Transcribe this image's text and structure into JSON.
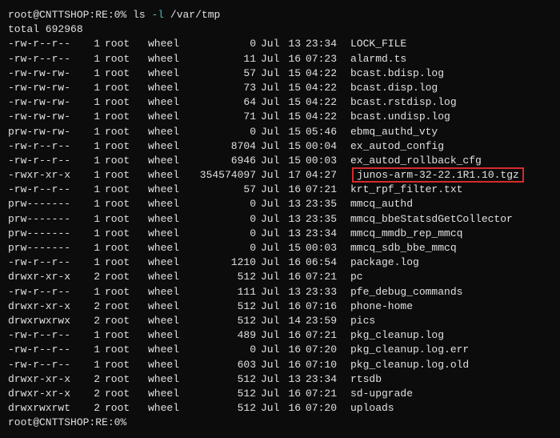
{
  "prompt": {
    "user_host": "root@CNTTSHOP",
    "path": ":RE:0%",
    "cmd": "ls",
    "flag": "-l",
    "arg": "/var/tmp",
    "end_user_host": "root@CNTTSHOP",
    "end_path": ":RE:0%"
  },
  "total": "total 692968",
  "rows": [
    {
      "perm": "-rw-r--r--",
      "links": "1",
      "owner": "root",
      "group": "wheel",
      "size": "0",
      "month": "Jul",
      "day": "13",
      "time": "23:34",
      "name": "LOCK_FILE",
      "hl": false
    },
    {
      "perm": "-rw-r--r--",
      "links": "1",
      "owner": "root",
      "group": "wheel",
      "size": "11",
      "month": "Jul",
      "day": "16",
      "time": "07:23",
      "name": "alarmd.ts",
      "hl": false
    },
    {
      "perm": "-rw-rw-rw-",
      "links": "1",
      "owner": "root",
      "group": "wheel",
      "size": "57",
      "month": "Jul",
      "day": "15",
      "time": "04:22",
      "name": "bcast.bdisp.log",
      "hl": false
    },
    {
      "perm": "-rw-rw-rw-",
      "links": "1",
      "owner": "root",
      "group": "wheel",
      "size": "73",
      "month": "Jul",
      "day": "15",
      "time": "04:22",
      "name": "bcast.disp.log",
      "hl": false
    },
    {
      "perm": "-rw-rw-rw-",
      "links": "1",
      "owner": "root",
      "group": "wheel",
      "size": "64",
      "month": "Jul",
      "day": "15",
      "time": "04:22",
      "name": "bcast.rstdisp.log",
      "hl": false
    },
    {
      "perm": "-rw-rw-rw-",
      "links": "1",
      "owner": "root",
      "group": "wheel",
      "size": "71",
      "month": "Jul",
      "day": "15",
      "time": "04:22",
      "name": "bcast.undisp.log",
      "hl": false
    },
    {
      "perm": "prw-rw-rw-",
      "links": "1",
      "owner": "root",
      "group": "wheel",
      "size": "0",
      "month": "Jul",
      "day": "15",
      "time": "05:46",
      "name": "ebmq_authd_vty",
      "hl": false
    },
    {
      "perm": "-rw-r--r--",
      "links": "1",
      "owner": "root",
      "group": "wheel",
      "size": "8704",
      "month": "Jul",
      "day": "15",
      "time": "00:04",
      "name": "ex_autod_config",
      "hl": false
    },
    {
      "perm": "-rw-r--r--",
      "links": "1",
      "owner": "root",
      "group": "wheel",
      "size": "6946",
      "month": "Jul",
      "day": "15",
      "time": "00:03",
      "name": "ex_autod_rollback_cfg",
      "hl": false
    },
    {
      "perm": "-rwxr-xr-x",
      "links": "1",
      "owner": "root",
      "group": "wheel",
      "size": "354574097",
      "month": "Jul",
      "day": "17",
      "time": "04:27",
      "name": "junos-arm-32-22.1R1.10.tgz",
      "hl": true
    },
    {
      "perm": "-rw-r--r--",
      "links": "1",
      "owner": "root",
      "group": "wheel",
      "size": "57",
      "month": "Jul",
      "day": "16",
      "time": "07:21",
      "name": "krt_rpf_filter.txt",
      "hl": false
    },
    {
      "perm": "prw-------",
      "links": "1",
      "owner": "root",
      "group": "wheel",
      "size": "0",
      "month": "Jul",
      "day": "13",
      "time": "23:35",
      "name": "mmcq_authd",
      "hl": false
    },
    {
      "perm": "prw-------",
      "links": "1",
      "owner": "root",
      "group": "wheel",
      "size": "0",
      "month": "Jul",
      "day": "13",
      "time": "23:35",
      "name": "mmcq_bbeStatsdGetCollector",
      "hl": false
    },
    {
      "perm": "prw-------",
      "links": "1",
      "owner": "root",
      "group": "wheel",
      "size": "0",
      "month": "Jul",
      "day": "13",
      "time": "23:34",
      "name": "mmcq_mmdb_rep_mmcq",
      "hl": false
    },
    {
      "perm": "prw-------",
      "links": "1",
      "owner": "root",
      "group": "wheel",
      "size": "0",
      "month": "Jul",
      "day": "15",
      "time": "00:03",
      "name": "mmcq_sdb_bbe_mmcq",
      "hl": false
    },
    {
      "perm": "-rw-r--r--",
      "links": "1",
      "owner": "root",
      "group": "wheel",
      "size": "1210",
      "month": "Jul",
      "day": "16",
      "time": "06:54",
      "name": "package.log",
      "hl": false
    },
    {
      "perm": "drwxr-xr-x",
      "links": "2",
      "owner": "root",
      "group": "wheel",
      "size": "512",
      "month": "Jul",
      "day": "16",
      "time": "07:21",
      "name": "pc",
      "hl": false
    },
    {
      "perm": "-rw-r--r--",
      "links": "1",
      "owner": "root",
      "group": "wheel",
      "size": "111",
      "month": "Jul",
      "day": "13",
      "time": "23:33",
      "name": "pfe_debug_commands",
      "hl": false
    },
    {
      "perm": "drwxr-xr-x",
      "links": "2",
      "owner": "root",
      "group": "wheel",
      "size": "512",
      "month": "Jul",
      "day": "16",
      "time": "07:16",
      "name": "phone-home",
      "hl": false
    },
    {
      "perm": "drwxrwxrwx",
      "links": "2",
      "owner": "root",
      "group": "wheel",
      "size": "512",
      "month": "Jul",
      "day": "14",
      "time": "23:59",
      "name": "pics",
      "hl": false
    },
    {
      "perm": "-rw-r--r--",
      "links": "1",
      "owner": "root",
      "group": "wheel",
      "size": "489",
      "month": "Jul",
      "day": "16",
      "time": "07:21",
      "name": "pkg_cleanup.log",
      "hl": false
    },
    {
      "perm": "-rw-r--r--",
      "links": "1",
      "owner": "root",
      "group": "wheel",
      "size": "0",
      "month": "Jul",
      "day": "16",
      "time": "07:20",
      "name": "pkg_cleanup.log.err",
      "hl": false
    },
    {
      "perm": "-rw-r--r--",
      "links": "1",
      "owner": "root",
      "group": "wheel",
      "size": "603",
      "month": "Jul",
      "day": "16",
      "time": "07:10",
      "name": "pkg_cleanup.log.old",
      "hl": false
    },
    {
      "perm": "drwxr-xr-x",
      "links": "2",
      "owner": "root",
      "group": "wheel",
      "size": "512",
      "month": "Jul",
      "day": "13",
      "time": "23:34",
      "name": "rtsdb",
      "hl": false
    },
    {
      "perm": "drwxr-xr-x",
      "links": "2",
      "owner": "root",
      "group": "wheel",
      "size": "512",
      "month": "Jul",
      "day": "16",
      "time": "07:21",
      "name": "sd-upgrade",
      "hl": false
    },
    {
      "perm": "drwxrwxrwt",
      "links": "2",
      "owner": "root",
      "group": "wheel",
      "size": "512",
      "month": "Jul",
      "day": "16",
      "time": "07:20",
      "name": "uploads",
      "hl": false
    }
  ]
}
